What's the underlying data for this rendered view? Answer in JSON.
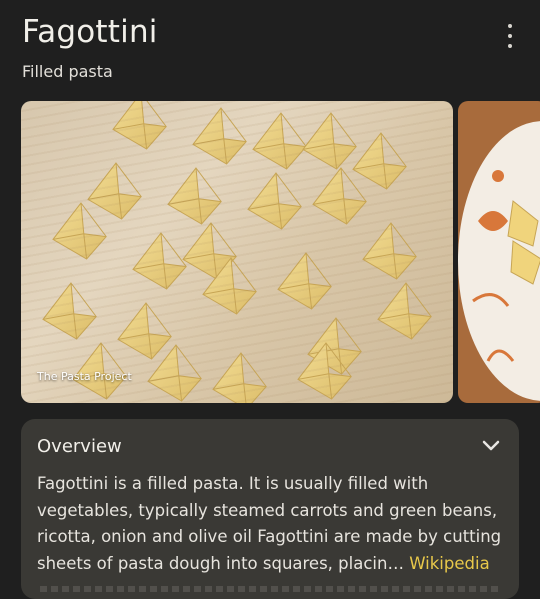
{
  "header": {
    "title": "Fagottini",
    "subtitle": "Filled pasta",
    "more_icon": "more-vert-icon"
  },
  "gallery": {
    "main_image_credit": "The Pasta Project",
    "main_image_subject": "fagottini-pasta-on-floured-board",
    "second_image_subject": "fagottini-on-decorated-plate"
  },
  "overview": {
    "title": "Overview",
    "expand_icon": "chevron-down-icon",
    "body": "Fagottini is a filled pasta. It is usually filled with vegetables, typically steamed carrots and green beans, ricotta, onion and olive oil Fagottini are made by cutting sheets of pasta dough into squares, placin…",
    "source_link": "Wikipedia"
  },
  "colors": {
    "background": "#1f1f1f",
    "card": "#3a3935",
    "link": "#e8c84a"
  }
}
